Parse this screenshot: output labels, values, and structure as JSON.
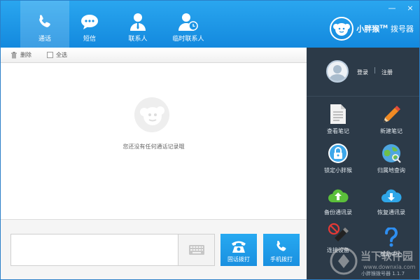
{
  "tabs": [
    {
      "label": "通话",
      "icon": "phone-icon",
      "active": true
    },
    {
      "label": "短信",
      "icon": "sms-bubble-icon",
      "active": false
    },
    {
      "label": "联系人",
      "icon": "contact-person-icon",
      "active": false
    },
    {
      "label": "临时联系人",
      "icon": "temp-contact-icon",
      "active": false
    }
  ],
  "window": {
    "minimize": "—",
    "close": "×"
  },
  "brand": {
    "name": "小胖猴",
    "tm": "TM",
    "subtitle": "拨号器"
  },
  "toolbar": {
    "delete_label": "删除",
    "select_all_label": "全选"
  },
  "main": {
    "empty_text": "您还没有任何通话记录哦"
  },
  "dial": {
    "input_value": "",
    "landline_label": "固话拨打",
    "mobile_label": "手机拨打"
  },
  "account": {
    "login": "登录",
    "separator": "|",
    "register": "注册"
  },
  "functions": [
    {
      "label": "查看笔记",
      "icon": "note-icon"
    },
    {
      "label": "新建笔记",
      "icon": "pencil-icon"
    },
    {
      "label": "锁定小胖猴",
      "icon": "lock-icon"
    },
    {
      "label": "归属地查询",
      "icon": "map-icon"
    },
    {
      "label": "备份通讯录",
      "icon": "cloud-upload-icon"
    },
    {
      "label": "恢复通讯录",
      "icon": "cloud-download-icon"
    },
    {
      "label": "连接设备",
      "icon": "usb-device-icon"
    },
    {
      "label": "帮助中心",
      "icon": "help-icon"
    }
  ],
  "version": "小胖猴拨号器 1.1.7",
  "watermark": {
    "title": "当下软件园",
    "url": "www.downxia.com"
  },
  "colors": {
    "accent": "#1f98e8",
    "panel": "#2c3a48"
  }
}
